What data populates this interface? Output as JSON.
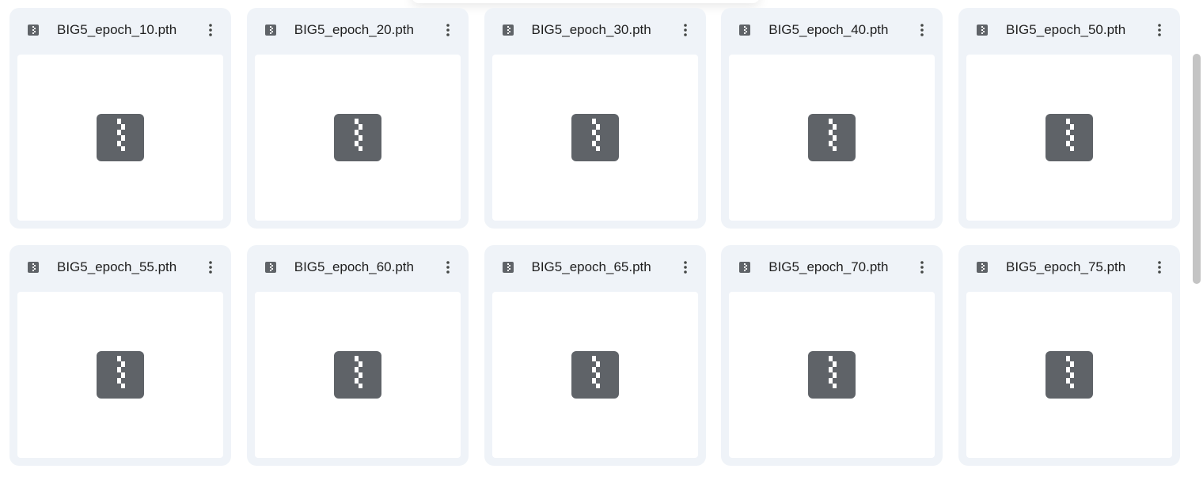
{
  "colors": {
    "card_background": "#eff3f8",
    "icon_gray": "#5f6368",
    "text": "#1f1f1f"
  },
  "file_type_icon": "zip-archive-icon",
  "menu_icon": "more-vert-icon",
  "files": [
    {
      "name": "BIG5_epoch_10.pth"
    },
    {
      "name": "BIG5_epoch_20.pth"
    },
    {
      "name": "BIG5_epoch_30.pth"
    },
    {
      "name": "BIG5_epoch_40.pth"
    },
    {
      "name": "BIG5_epoch_50.pth"
    },
    {
      "name": "BIG5_epoch_55.pth"
    },
    {
      "name": "BIG5_epoch_60.pth"
    },
    {
      "name": "BIG5_epoch_65.pth"
    },
    {
      "name": "BIG5_epoch_70.pth"
    },
    {
      "name": "BIG5_epoch_75.pth"
    }
  ]
}
